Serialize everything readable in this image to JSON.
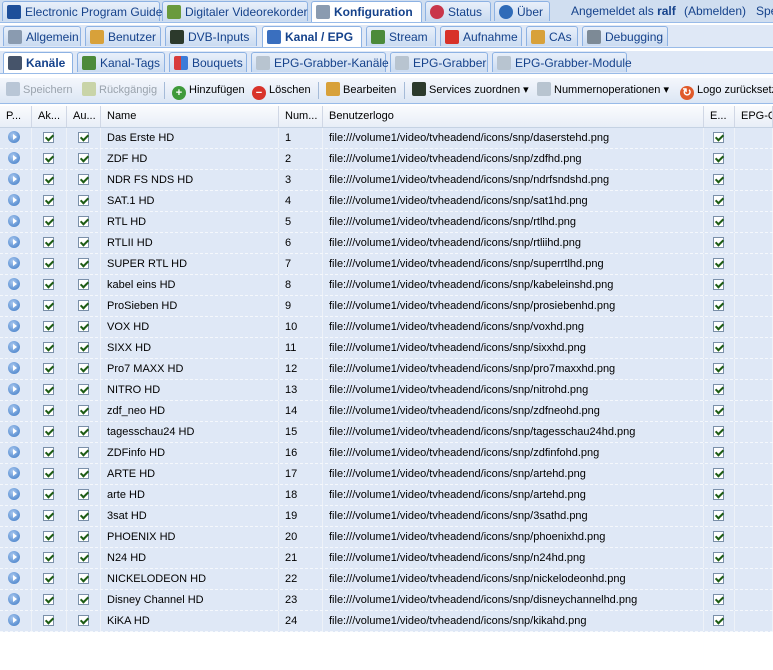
{
  "top_tabs": [
    {
      "label": "Electronic Program Guide",
      "icon": "epg-icon"
    },
    {
      "label": "Digitaler Videorekorder",
      "icon": "download-icon"
    },
    {
      "label": "Konfiguration",
      "icon": "wrench-icon",
      "active": true
    },
    {
      "label": "Status",
      "icon": "eye-icon"
    },
    {
      "label": "Über",
      "icon": "info-icon"
    }
  ],
  "session": {
    "logged_in_prefix": "Angemeldet als",
    "user": "ralf",
    "logout": "(Abmelden)",
    "extra": "Spe"
  },
  "config_tabs": [
    {
      "label": "Allgemein"
    },
    {
      "label": "Benutzer"
    },
    {
      "label": "DVB-Inputs"
    },
    {
      "label": "Kanal / EPG",
      "active": true
    },
    {
      "label": "Stream"
    },
    {
      "label": "Aufnahme"
    },
    {
      "label": "CAs"
    },
    {
      "label": "Debugging"
    }
  ],
  "sub_tabs": [
    {
      "label": "Kanäle",
      "active": true
    },
    {
      "label": "Kanal-Tags"
    },
    {
      "label": "Bouquets"
    },
    {
      "label": "EPG-Grabber-Kanäle"
    },
    {
      "label": "EPG-Grabber"
    },
    {
      "label": "EPG-Grabber-Module"
    }
  ],
  "toolbar": {
    "save": "Speichern",
    "undo": "Rückgängig",
    "add": "Hinzufügen",
    "delete": "Löschen",
    "edit": "Bearbeiten",
    "map_services": "Services zuordnen",
    "number_ops": "Nummernoperationen",
    "reset_logo": "Logo zurücksetz"
  },
  "columns": {
    "play": "P...",
    "enabled": "Ak...",
    "auto": "Au...",
    "name": "Name",
    "number": "Num...",
    "icon": "Benutzerlogo",
    "epg": "E...",
    "epg_source": "EPG-Q"
  },
  "rows": [
    {
      "name": "Das Erste HD",
      "number": "1",
      "icon": "file:///volume1/video/tvheadend/icons/snp/daserstehd.png"
    },
    {
      "name": "ZDF HD",
      "number": "2",
      "icon": "file:///volume1/video/tvheadend/icons/snp/zdfhd.png"
    },
    {
      "name": "NDR FS NDS HD",
      "number": "3",
      "icon": "file:///volume1/video/tvheadend/icons/snp/ndrfsndshd.png"
    },
    {
      "name": "SAT.1 HD",
      "number": "4",
      "icon": "file:///volume1/video/tvheadend/icons/snp/sat1hd.png"
    },
    {
      "name": "RTL HD",
      "number": "5",
      "icon": "file:///volume1/video/tvheadend/icons/snp/rtlhd.png"
    },
    {
      "name": "RTLII HD",
      "number": "6",
      "icon": "file:///volume1/video/tvheadend/icons/snp/rtliihd.png"
    },
    {
      "name": "SUPER RTL HD",
      "number": "7",
      "icon": "file:///volume1/video/tvheadend/icons/snp/superrtlhd.png"
    },
    {
      "name": "kabel eins HD",
      "number": "8",
      "icon": "file:///volume1/video/tvheadend/icons/snp/kabeleinshd.png"
    },
    {
      "name": "ProSieben HD",
      "number": "9",
      "icon": "file:///volume1/video/tvheadend/icons/snp/prosiebenhd.png"
    },
    {
      "name": "VOX HD",
      "number": "10",
      "icon": "file:///volume1/video/tvheadend/icons/snp/voxhd.png"
    },
    {
      "name": "SIXX HD",
      "number": "11",
      "icon": "file:///volume1/video/tvheadend/icons/snp/sixxhd.png"
    },
    {
      "name": "Pro7 MAXX HD",
      "number": "12",
      "icon": "file:///volume1/video/tvheadend/icons/snp/pro7maxxhd.png"
    },
    {
      "name": "NITRO HD",
      "number": "13",
      "icon": "file:///volume1/video/tvheadend/icons/snp/nitrohd.png"
    },
    {
      "name": "zdf_neo HD",
      "number": "14",
      "icon": "file:///volume1/video/tvheadend/icons/snp/zdfneohd.png"
    },
    {
      "name": "tagesschau24 HD",
      "number": "15",
      "icon": "file:///volume1/video/tvheadend/icons/snp/tagesschau24hd.png"
    },
    {
      "name": "ZDFinfo HD",
      "number": "16",
      "icon": "file:///volume1/video/tvheadend/icons/snp/zdfinfohd.png"
    },
    {
      "name": "ARTE HD",
      "number": "17",
      "icon": "file:///volume1/video/tvheadend/icons/snp/artehd.png"
    },
    {
      "name": "arte HD",
      "number": "18",
      "icon": "file:///volume1/video/tvheadend/icons/snp/artehd.png"
    },
    {
      "name": "3sat HD",
      "number": "19",
      "icon": "file:///volume1/video/tvheadend/icons/snp/3sathd.png"
    },
    {
      "name": "PHOENIX HD",
      "number": "20",
      "icon": "file:///volume1/video/tvheadend/icons/snp/phoenixhd.png"
    },
    {
      "name": "N24 HD",
      "number": "21",
      "icon": "file:///volume1/video/tvheadend/icons/snp/n24hd.png"
    },
    {
      "name": "NICKELODEON HD",
      "number": "22",
      "icon": "file:///volume1/video/tvheadend/icons/snp/nickelodeonhd.png"
    },
    {
      "name": "Disney Channel HD",
      "number": "23",
      "icon": "file:///volume1/video/tvheadend/icons/snp/disneychannelhd.png"
    },
    {
      "name": "KiKA HD",
      "number": "24",
      "icon": "file:///volume1/video/tvheadend/icons/snp/kikahd.png"
    }
  ]
}
